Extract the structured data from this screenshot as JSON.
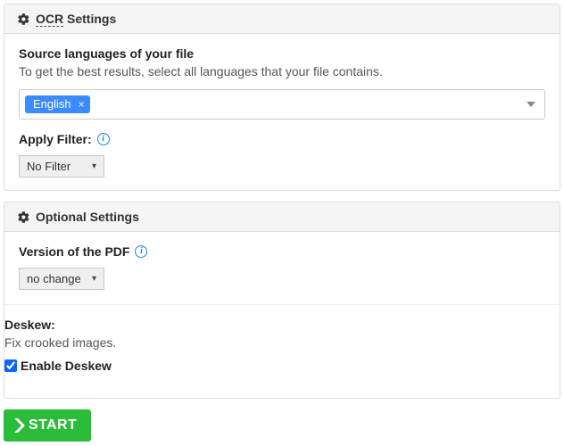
{
  "ocr_panel": {
    "title_prefix": "OCR",
    "title_suffix": " Settings",
    "source_lang_label": "Source languages of your file",
    "source_lang_help": "To get the best results, select all languages that your file contains.",
    "selected_language": "English",
    "apply_filter_label": "Apply Filter:",
    "filter_value": "No Filter"
  },
  "optional_panel": {
    "title": "Optional Settings",
    "pdf_version_label": "Version of the PDF",
    "pdf_version_value": "no change",
    "deskew_label": "Deskew:",
    "deskew_help": "Fix crooked images.",
    "enable_deskew_label": "Enable Deskew",
    "enable_deskew_checked": true
  },
  "start_button_label": "START"
}
